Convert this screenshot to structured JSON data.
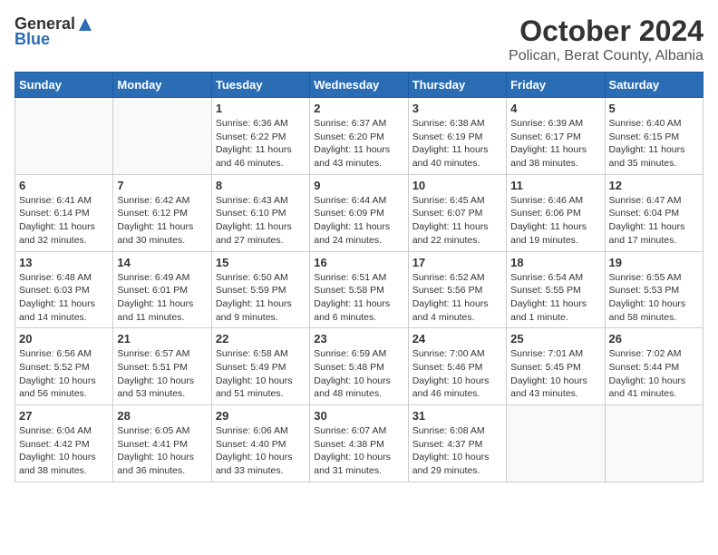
{
  "header": {
    "logo_general": "General",
    "logo_blue": "Blue",
    "title": "October 2024",
    "subtitle": "Polican, Berat County, Albania"
  },
  "calendar": {
    "days_of_week": [
      "Sunday",
      "Monday",
      "Tuesday",
      "Wednesday",
      "Thursday",
      "Friday",
      "Saturday"
    ],
    "weeks": [
      [
        {
          "day": "",
          "sunrise": "",
          "sunset": "",
          "daylight": ""
        },
        {
          "day": "",
          "sunrise": "",
          "sunset": "",
          "daylight": ""
        },
        {
          "day": "1",
          "sunrise": "Sunrise: 6:36 AM",
          "sunset": "Sunset: 6:22 PM",
          "daylight": "Daylight: 11 hours and 46 minutes."
        },
        {
          "day": "2",
          "sunrise": "Sunrise: 6:37 AM",
          "sunset": "Sunset: 6:20 PM",
          "daylight": "Daylight: 11 hours and 43 minutes."
        },
        {
          "day": "3",
          "sunrise": "Sunrise: 6:38 AM",
          "sunset": "Sunset: 6:19 PM",
          "daylight": "Daylight: 11 hours and 40 minutes."
        },
        {
          "day": "4",
          "sunrise": "Sunrise: 6:39 AM",
          "sunset": "Sunset: 6:17 PM",
          "daylight": "Daylight: 11 hours and 38 minutes."
        },
        {
          "day": "5",
          "sunrise": "Sunrise: 6:40 AM",
          "sunset": "Sunset: 6:15 PM",
          "daylight": "Daylight: 11 hours and 35 minutes."
        }
      ],
      [
        {
          "day": "6",
          "sunrise": "Sunrise: 6:41 AM",
          "sunset": "Sunset: 6:14 PM",
          "daylight": "Daylight: 11 hours and 32 minutes."
        },
        {
          "day": "7",
          "sunrise": "Sunrise: 6:42 AM",
          "sunset": "Sunset: 6:12 PM",
          "daylight": "Daylight: 11 hours and 30 minutes."
        },
        {
          "day": "8",
          "sunrise": "Sunrise: 6:43 AM",
          "sunset": "Sunset: 6:10 PM",
          "daylight": "Daylight: 11 hours and 27 minutes."
        },
        {
          "day": "9",
          "sunrise": "Sunrise: 6:44 AM",
          "sunset": "Sunset: 6:09 PM",
          "daylight": "Daylight: 11 hours and 24 minutes."
        },
        {
          "day": "10",
          "sunrise": "Sunrise: 6:45 AM",
          "sunset": "Sunset: 6:07 PM",
          "daylight": "Daylight: 11 hours and 22 minutes."
        },
        {
          "day": "11",
          "sunrise": "Sunrise: 6:46 AM",
          "sunset": "Sunset: 6:06 PM",
          "daylight": "Daylight: 11 hours and 19 minutes."
        },
        {
          "day": "12",
          "sunrise": "Sunrise: 6:47 AM",
          "sunset": "Sunset: 6:04 PM",
          "daylight": "Daylight: 11 hours and 17 minutes."
        }
      ],
      [
        {
          "day": "13",
          "sunrise": "Sunrise: 6:48 AM",
          "sunset": "Sunset: 6:03 PM",
          "daylight": "Daylight: 11 hours and 14 minutes."
        },
        {
          "day": "14",
          "sunrise": "Sunrise: 6:49 AM",
          "sunset": "Sunset: 6:01 PM",
          "daylight": "Daylight: 11 hours and 11 minutes."
        },
        {
          "day": "15",
          "sunrise": "Sunrise: 6:50 AM",
          "sunset": "Sunset: 5:59 PM",
          "daylight": "Daylight: 11 hours and 9 minutes."
        },
        {
          "day": "16",
          "sunrise": "Sunrise: 6:51 AM",
          "sunset": "Sunset: 5:58 PM",
          "daylight": "Daylight: 11 hours and 6 minutes."
        },
        {
          "day": "17",
          "sunrise": "Sunrise: 6:52 AM",
          "sunset": "Sunset: 5:56 PM",
          "daylight": "Daylight: 11 hours and 4 minutes."
        },
        {
          "day": "18",
          "sunrise": "Sunrise: 6:54 AM",
          "sunset": "Sunset: 5:55 PM",
          "daylight": "Daylight: 11 hours and 1 minute."
        },
        {
          "day": "19",
          "sunrise": "Sunrise: 6:55 AM",
          "sunset": "Sunset: 5:53 PM",
          "daylight": "Daylight: 10 hours and 58 minutes."
        }
      ],
      [
        {
          "day": "20",
          "sunrise": "Sunrise: 6:56 AM",
          "sunset": "Sunset: 5:52 PM",
          "daylight": "Daylight: 10 hours and 56 minutes."
        },
        {
          "day": "21",
          "sunrise": "Sunrise: 6:57 AM",
          "sunset": "Sunset: 5:51 PM",
          "daylight": "Daylight: 10 hours and 53 minutes."
        },
        {
          "day": "22",
          "sunrise": "Sunrise: 6:58 AM",
          "sunset": "Sunset: 5:49 PM",
          "daylight": "Daylight: 10 hours and 51 minutes."
        },
        {
          "day": "23",
          "sunrise": "Sunrise: 6:59 AM",
          "sunset": "Sunset: 5:48 PM",
          "daylight": "Daylight: 10 hours and 48 minutes."
        },
        {
          "day": "24",
          "sunrise": "Sunrise: 7:00 AM",
          "sunset": "Sunset: 5:46 PM",
          "daylight": "Daylight: 10 hours and 46 minutes."
        },
        {
          "day": "25",
          "sunrise": "Sunrise: 7:01 AM",
          "sunset": "Sunset: 5:45 PM",
          "daylight": "Daylight: 10 hours and 43 minutes."
        },
        {
          "day": "26",
          "sunrise": "Sunrise: 7:02 AM",
          "sunset": "Sunset: 5:44 PM",
          "daylight": "Daylight: 10 hours and 41 minutes."
        }
      ],
      [
        {
          "day": "27",
          "sunrise": "Sunrise: 6:04 AM",
          "sunset": "Sunset: 4:42 PM",
          "daylight": "Daylight: 10 hours and 38 minutes."
        },
        {
          "day": "28",
          "sunrise": "Sunrise: 6:05 AM",
          "sunset": "Sunset: 4:41 PM",
          "daylight": "Daylight: 10 hours and 36 minutes."
        },
        {
          "day": "29",
          "sunrise": "Sunrise: 6:06 AM",
          "sunset": "Sunset: 4:40 PM",
          "daylight": "Daylight: 10 hours and 33 minutes."
        },
        {
          "day": "30",
          "sunrise": "Sunrise: 6:07 AM",
          "sunset": "Sunset: 4:38 PM",
          "daylight": "Daylight: 10 hours and 31 minutes."
        },
        {
          "day": "31",
          "sunrise": "Sunrise: 6:08 AM",
          "sunset": "Sunset: 4:37 PM",
          "daylight": "Daylight: 10 hours and 29 minutes."
        },
        {
          "day": "",
          "sunrise": "",
          "sunset": "",
          "daylight": ""
        },
        {
          "day": "",
          "sunrise": "",
          "sunset": "",
          "daylight": ""
        }
      ]
    ]
  }
}
